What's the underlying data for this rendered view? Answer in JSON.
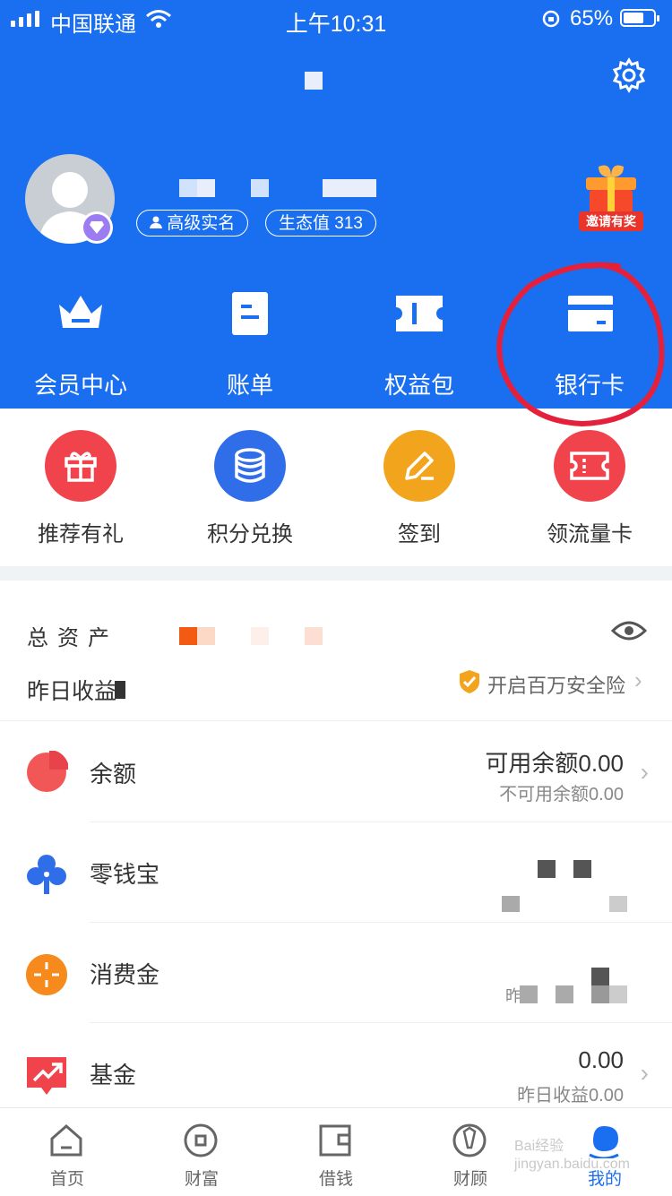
{
  "status_bar": {
    "carrier": "中国联通",
    "time": "上午10:31",
    "battery": "65%"
  },
  "profile": {
    "verify_badge": "高级实名",
    "eco_value": "生态值 313",
    "invite": "邀请有奖"
  },
  "quick_actions": [
    {
      "label": "会员中心",
      "icon": "crown-icon"
    },
    {
      "label": "账单",
      "icon": "bill-icon"
    },
    {
      "label": "权益包",
      "icon": "ticket-icon"
    },
    {
      "label": "银行卡",
      "icon": "bank-card-icon"
    }
  ],
  "features": [
    {
      "label": "推荐有礼",
      "icon": "gift-icon",
      "color": "#f0434c"
    },
    {
      "label": "积分兑换",
      "icon": "coins-icon",
      "color": "#2f6ee8"
    },
    {
      "label": "签到",
      "icon": "pencil-icon",
      "color": "#f2a51c"
    },
    {
      "label": "领流量卡",
      "icon": "ticket-icon",
      "color": "#f0434c"
    }
  ],
  "assets": {
    "total_label": "总资产",
    "yesterday_label": "昨日收益",
    "insurance": "开启百万安全险"
  },
  "accounts": [
    {
      "name": "余额",
      "icon": "pie-chart-icon",
      "value": "可用余额0.00",
      "sub": "不可用余额0.00"
    },
    {
      "name": "零钱宝",
      "icon": "clover-icon",
      "value": "",
      "sub": ""
    },
    {
      "name": "消费金",
      "icon": "target-icon",
      "value": "",
      "sub": "昨"
    },
    {
      "name": "基金",
      "icon": "trend-icon",
      "value": "0.00",
      "sub": "昨日收益0.00"
    }
  ],
  "tabs": [
    {
      "label": "首页",
      "icon": "home-icon"
    },
    {
      "label": "财富",
      "icon": "coin-icon"
    },
    {
      "label": "借钱",
      "icon": "wallet-icon"
    },
    {
      "label": "财顾",
      "icon": "advisor-icon"
    },
    {
      "label": "我的",
      "icon": "profile-icon",
      "active": true
    }
  ],
  "watermark": "Bai经验 jingyan.baidu.com",
  "colors": {
    "header_blue": "#1a6ff0",
    "active_tab": "#1a6ff0",
    "annotation_red": "#e5203b"
  }
}
